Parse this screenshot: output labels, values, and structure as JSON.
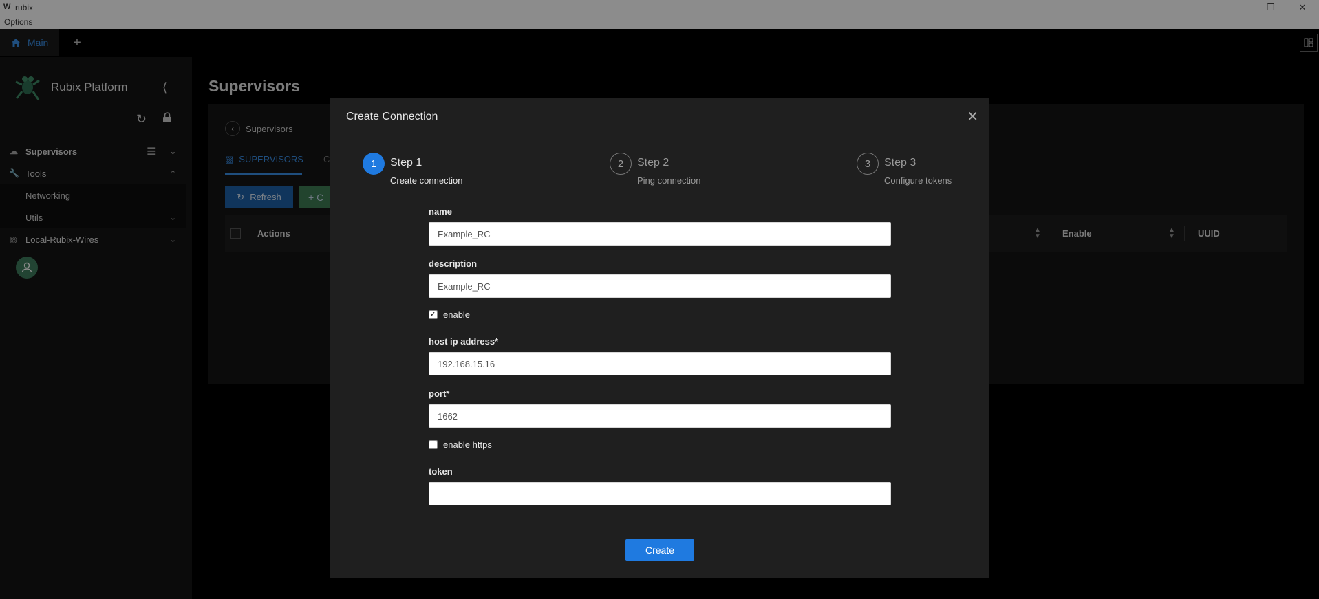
{
  "window": {
    "logo": "W",
    "title": "rubix",
    "controls": {
      "minimize": "—",
      "restore": "❐",
      "close": "✕"
    }
  },
  "menu": {
    "options": "Options"
  },
  "tabs": {
    "main_label": "Main",
    "add_label": "+",
    "layout_icon": "grid-layout-icon"
  },
  "sidebar": {
    "brand": "Rubix Platform",
    "items": [
      {
        "label": "Supervisors",
        "icon": "cloud-icon",
        "active": true
      },
      {
        "label": "Tools",
        "icon": "wrench-icon"
      },
      {
        "label": "Networking"
      },
      {
        "label": "Utils"
      },
      {
        "label": "Local-Rubix-Wires",
        "icon": "network-icon"
      }
    ]
  },
  "page": {
    "title": "Supervisors",
    "breadcrumb": "Supervisors",
    "tab_active": "SUPERVISORS",
    "tab_next": "C",
    "refresh_label": "Refresh",
    "add_label": "+ C",
    "table_headers": {
      "actions": "Actions",
      "enable": "Enable",
      "uuid": "UUID"
    }
  },
  "modal": {
    "title": "Create Connection",
    "steps": [
      {
        "number": "1",
        "title": "Step 1",
        "description": "Create connection",
        "state": "active"
      },
      {
        "number": "2",
        "title": "Step 2",
        "description": "Ping connection",
        "state": "wait"
      },
      {
        "number": "3",
        "title": "Step 3",
        "description": "Configure tokens",
        "state": "wait"
      }
    ],
    "fields": {
      "name": {
        "label": "name",
        "value": "Example_RC"
      },
      "description": {
        "label": "description",
        "value": "Example_RC"
      },
      "enable": {
        "label": "enable",
        "checked": true
      },
      "host": {
        "label": "host ip address*",
        "value": "192.168.15.16"
      },
      "port": {
        "label": "port*",
        "value": "1662"
      },
      "https": {
        "label": "enable https",
        "checked": false
      },
      "token": {
        "label": "token",
        "value": ""
      }
    },
    "submit_label": "Create"
  },
  "colors": {
    "accent": "#1f7ae0",
    "link": "#3a8ee6",
    "success": "#3f7d55",
    "background": "#000000",
    "modal": "#1f1f1f"
  }
}
